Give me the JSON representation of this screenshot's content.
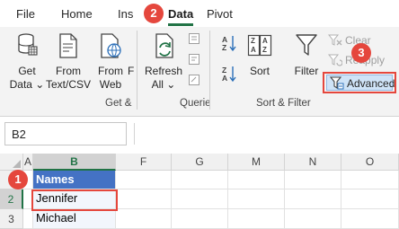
{
  "menu": {
    "tabs": [
      {
        "label": "File"
      },
      {
        "label": "Home"
      },
      {
        "label": "Ins"
      },
      {
        "label": "Data",
        "active": true
      },
      {
        "label": "Pivot"
      }
    ]
  },
  "ribbon": {
    "get_transform": {
      "buttons": [
        {
          "label": "Get",
          "label2": "Data ⌄",
          "icon": "database-icon"
        },
        {
          "label": "From",
          "label2": "Text/CSV",
          "icon": "text-file-icon"
        },
        {
          "label": "From",
          "label2": "Web",
          "icon": "web-icon"
        },
        {
          "label": "F",
          "label2": "",
          "icon": "truncated-icon"
        }
      ],
      "group_label": "Get &"
    },
    "queries": {
      "refresh": {
        "label": "Refresh",
        "label2": "All ⌄",
        "icon": "refresh-icon"
      },
      "group_label": "Querie"
    },
    "sort_filter": {
      "sort_az_icon": "sort-az-icon",
      "sort_za_icon": "sort-za-icon",
      "sort": {
        "label": "Sort",
        "icon": "sort-dialog-icon"
      },
      "filter": {
        "label": "Filter",
        "icon": "funnel-icon"
      },
      "clear": {
        "label": "Clear",
        "icon": "clear-filter-icon"
      },
      "reapply": {
        "label": "Reapply",
        "icon": "reapply-icon"
      },
      "advanced": {
        "label": "Advanced",
        "icon": "advanced-filter-icon"
      },
      "group_label": "Sort & Filter"
    }
  },
  "formula_bar": {
    "name_box": "B2",
    "formula": ""
  },
  "sheet": {
    "columns": [
      "A",
      "B",
      "F",
      "G",
      "M",
      "N",
      "O"
    ],
    "selected_column": "B",
    "rows": [
      {
        "label": "1",
        "b": "Names"
      },
      {
        "label": "2",
        "b": "Jennifer"
      },
      {
        "label": "3",
        "b": "Michael"
      }
    ],
    "selected_row": "2"
  },
  "annotations": {
    "steps": [
      {
        "number": "1"
      },
      {
        "number": "2"
      },
      {
        "number": "3"
      }
    ]
  },
  "colors": {
    "accent": "#217346",
    "highlight": "#e5473d",
    "table_header": "#4472c4"
  }
}
